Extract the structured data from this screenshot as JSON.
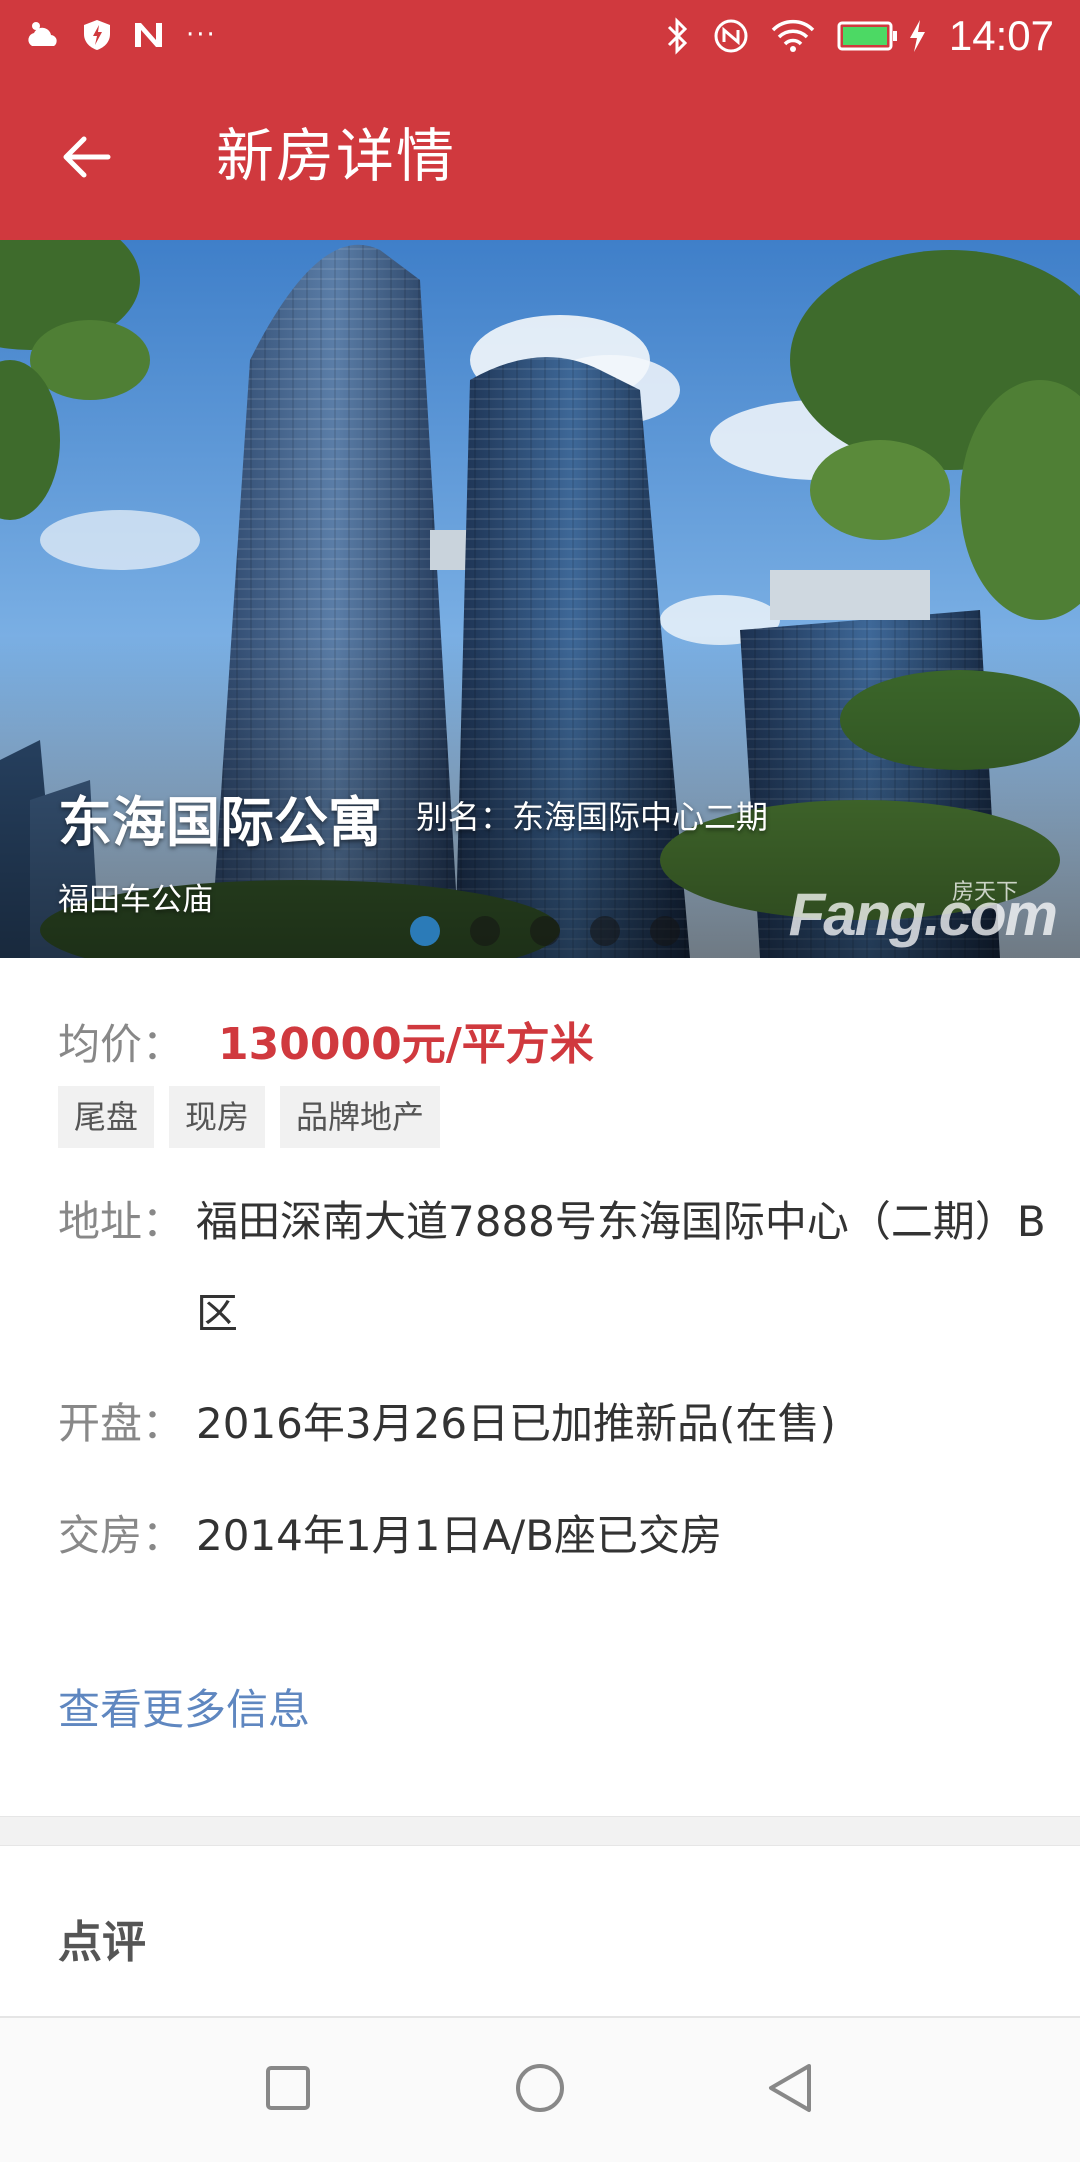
{
  "status_bar": {
    "time": "14:07",
    "left_icons": [
      "cloud-weather-icon",
      "shield-icon",
      "n-badge-icon",
      "more-dots-icon"
    ],
    "right_icons": [
      "bluetooth-icon",
      "nfc-icon",
      "wifi-icon",
      "battery-icon",
      "charging-icon"
    ],
    "overflow_text": "···"
  },
  "app_bar": {
    "title": "新房详情",
    "back_icon": "arrow-left-icon"
  },
  "hero": {
    "name": "东海国际公寓",
    "alias": "别名：东海国际中心二期",
    "area": "福田车公庙",
    "carousel_total": 5,
    "carousel_active": 1,
    "watermark_cn": "房天下",
    "watermark_en": "Fang.com"
  },
  "details": {
    "price_label": "均价：",
    "price_value": "130000元/平方米",
    "tags": [
      "尾盘",
      "现房",
      "品牌地产"
    ],
    "address_label": "地址：",
    "address_value": "福田深南大道7888号东海国际中心（二期）B区",
    "opening_label": "开盘：",
    "opening_value": "2016年3月26日已加推新品(在售)",
    "delivery_label": "交房：",
    "delivery_value": "2014年1月1日A/B座已交房",
    "more_link": "查看更多信息"
  },
  "review": {
    "title": "点评"
  },
  "colors": {
    "brand_red": "#d0393e",
    "link_blue": "#5f87c0",
    "dot_active": "#2b7bb8"
  }
}
